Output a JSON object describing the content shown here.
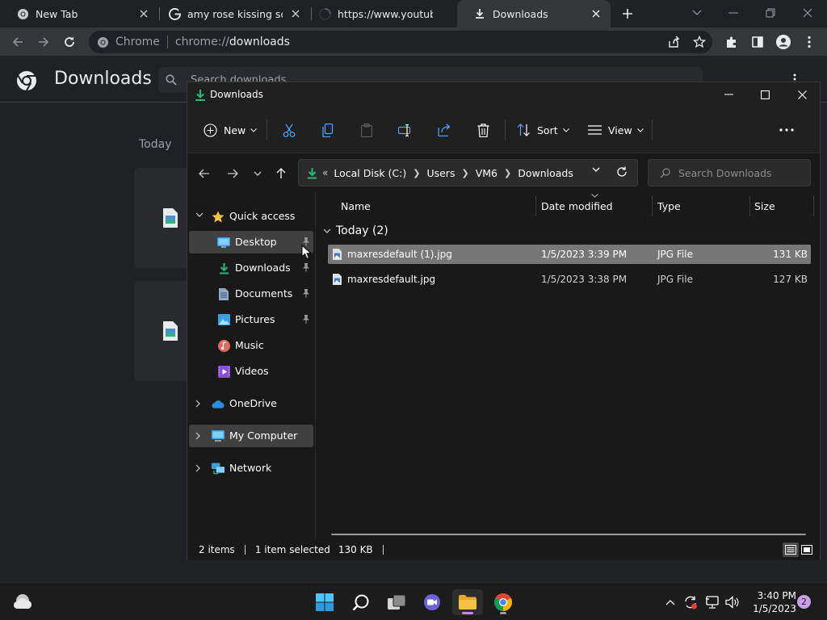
{
  "browser": {
    "tabs": [
      {
        "title": "New Tab",
        "icon": "chrome-icon"
      },
      {
        "title": "amy rose kissing sonic",
        "icon": "google-icon"
      },
      {
        "title": "https://www.youtube.c",
        "icon": "loading-icon"
      },
      {
        "title": "Downloads",
        "icon": "download-icon",
        "active": true
      }
    ],
    "omnibox": {
      "chip": "Chrome",
      "url_scheme": "chrome://",
      "url_host": "downloads"
    }
  },
  "downloads_page": {
    "title": "Downloads",
    "search_placeholder": "Search downloads",
    "group_label": "Today"
  },
  "explorer": {
    "title": "Downloads",
    "commands": {
      "new": "New",
      "sort": "Sort",
      "view": "View"
    },
    "breadcrumb": [
      "Local Disk (C:)",
      "Users",
      "VM6",
      "Downloads"
    ],
    "search_placeholder": "Search Downloads",
    "nav": {
      "quick_access": "Quick access",
      "desktop": "Desktop",
      "downloads": "Downloads",
      "documents": "Documents",
      "pictures": "Pictures",
      "music": "Music",
      "videos": "Videos",
      "onedrive": "OneDrive",
      "my_computer": "My Computer",
      "network": "Network"
    },
    "columns": {
      "name": "Name",
      "date": "Date modified",
      "type": "Type",
      "size": "Size"
    },
    "group": "Today (2)",
    "files": [
      {
        "name": "maxresdefault (1).jpg",
        "date": "1/5/2023 3:39 PM",
        "type": "JPG File",
        "size": "131 KB",
        "selected": true
      },
      {
        "name": "maxresdefault.jpg",
        "date": "1/5/2023 3:38 PM",
        "type": "JPG File",
        "size": "127 KB",
        "selected": false
      }
    ],
    "status": {
      "items": "2 items",
      "selected": "1 item selected",
      "size": "130 KB"
    }
  },
  "taskbar": {
    "time": "3:40 PM",
    "date": "1/5/2023",
    "notifications": "2"
  },
  "colors": {
    "accent_green": "#2fb872",
    "folder_yellow": "#f5c242",
    "chrome_bg": "#202124",
    "explorer_bg": "#191919"
  }
}
